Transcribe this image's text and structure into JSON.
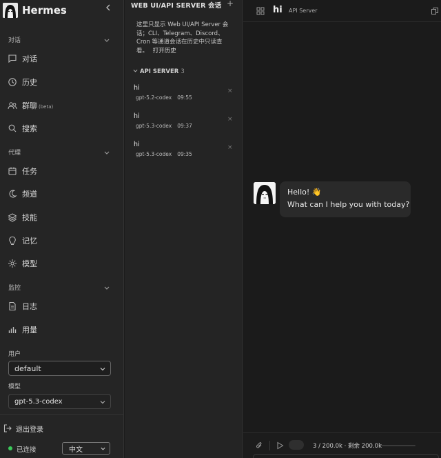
{
  "sidebar": {
    "brand": "Hermes",
    "sections": {
      "chat": "对话",
      "agent": "代理",
      "monitor": "监控"
    },
    "nav": {
      "conversation": "对话",
      "history": "历史",
      "group_chat": "群聊",
      "group_chat_badge": "(beta)",
      "search": "搜索",
      "tasks": "任务",
      "channels": "频道",
      "skills": "技能",
      "memory": "记忆",
      "models": "模型",
      "logs": "日志",
      "usage": "用量"
    },
    "user_label": "用户",
    "user_value": "default",
    "model_label": "模型",
    "model_value": "gpt-5.3-codex",
    "logout": "退出登录",
    "status": "已连接",
    "language": "中文",
    "colors": {
      "status": "#3bc95a"
    }
  },
  "sessions": {
    "header": "WEB UI/API SERVER 会话",
    "note": "这里只显示 Web UI/API Server 会话；CLI、Telegram、Discord、Cron 等通道会话在历史中只读查看。",
    "note_link": "打开历史",
    "group_title": "API SERVER",
    "group_count": "3",
    "items": [
      {
        "title": "hi",
        "model": "gpt-5.2-codex",
        "time": "09:55"
      },
      {
        "title": "hi",
        "model": "gpt-5.3-codex",
        "time": "09:37"
      },
      {
        "title": "hi",
        "model": "gpt-5.3-codex",
        "time": "09:35"
      }
    ]
  },
  "chat": {
    "title": "hi",
    "subtitle": "API Server",
    "message_line1": "Hello! 👋",
    "message_line2": "What can I help you with today?",
    "tokens": "3 / 200.0k · 剩余 200.0k",
    "context_used_fraction": 1.5e-05
  }
}
